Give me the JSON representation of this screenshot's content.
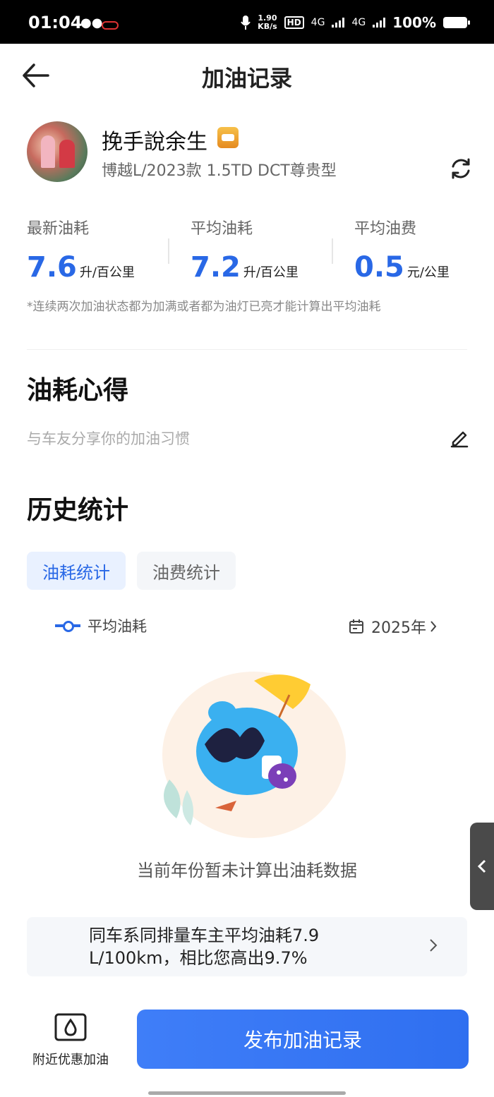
{
  "status_bar": {
    "time": "01:04",
    "net_speed_value": "1.90",
    "net_speed_unit": "KB/s",
    "hd_label": "HD",
    "sim1": "4G",
    "sim2": "4G",
    "battery": "100%"
  },
  "header": {
    "title": "加油记录"
  },
  "profile": {
    "username": "挽手說余生",
    "car_model": "博越L/2023款 1.5TD DCT尊贵型"
  },
  "stats": [
    {
      "label": "最新油耗",
      "value": "7.6",
      "unit": "升/百公里"
    },
    {
      "label": "平均油耗",
      "value": "7.2",
      "unit": "升/百公里"
    },
    {
      "label": "平均油费",
      "value": "0.5",
      "unit": "元/公里"
    }
  ],
  "stats_note": "*连续两次加油状态都为加满或者都为油灯已亮才能计算出平均油耗",
  "experience": {
    "title": "油耗心得",
    "placeholder": "与车友分享你的加油习惯"
  },
  "history": {
    "title": "历史统计",
    "tabs": [
      "油耗统计",
      "油费统计"
    ],
    "active_tab": 0,
    "legend": "平均油耗",
    "year": "2025年",
    "empty_text": "当前年份暂未计算出油耗数据"
  },
  "comparison": {
    "text": "同车系同排量车主平均油耗7.9 L/100km，相比您高出9.7%"
  },
  "bottom": {
    "nearby_label": "附近优惠加油",
    "publish_label": "发布加油记录"
  },
  "colors": {
    "accent": "#2968e6",
    "button": "#3373f4"
  }
}
